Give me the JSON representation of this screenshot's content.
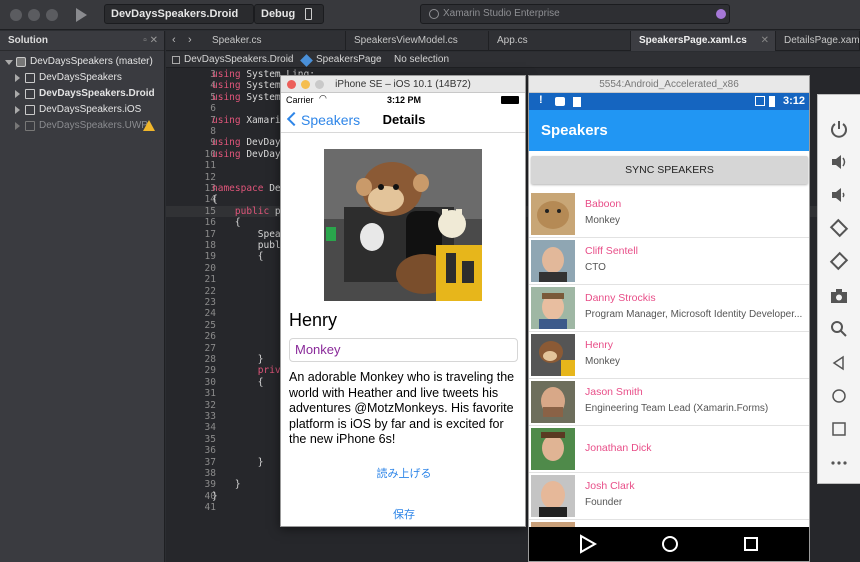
{
  "toolbar": {
    "config_project": "DevDaysSpeakers.Droid",
    "config_mode": "Debug",
    "status": "Xamarin Studio Enterprise"
  },
  "solution": {
    "title": "Solution",
    "root": "DevDaysSpeakers (master)",
    "projects": [
      "DevDaysSpeakers",
      "DevDaysSpeakers.Droid",
      "DevDaysSpeakers.iOS",
      "DevDaysSpeakers.UWP"
    ]
  },
  "tabs": [
    "Speaker.cs",
    "SpeakersViewModel.cs",
    "App.cs",
    "SpeakersPage.xaml.cs",
    "DetailsPage.xaml."
  ],
  "breadcrumbs": {
    "project": "DevDaysSpeakers.Droid",
    "type": "SpeakersPage",
    "member": "No selection"
  },
  "code_lines": [
    {
      "n": "3",
      "a": "using",
      "b": " System.Linq;"
    },
    {
      "n": "4",
      "a": "using",
      "b": " System."
    },
    {
      "n": "5",
      "a": "using",
      "b": " System."
    },
    {
      "n": "6",
      "a": "",
      "b": ""
    },
    {
      "n": "7",
      "a": "using",
      "b": " Xamarin"
    },
    {
      "n": "8",
      "a": "",
      "b": ""
    },
    {
      "n": "9",
      "a": "using",
      "b": " DevDay"
    },
    {
      "n": "10",
      "a": "using",
      "b": " DevDay"
    },
    {
      "n": "11",
      "a": "",
      "b": ""
    },
    {
      "n": "12",
      "a": "",
      "b": ""
    },
    {
      "n": "13",
      "a": "namespace",
      "b": " Dev"
    },
    {
      "n": "14",
      "a": "",
      "b": "{"
    },
    {
      "n": "15",
      "a": "    public",
      "b": " pa"
    },
    {
      "n": "16",
      "a": "",
      "b": "    {"
    },
    {
      "n": "17",
      "a": "",
      "b": "        Spea"
    },
    {
      "n": "18",
      "a": "",
      "b": "        publ"
    },
    {
      "n": "19",
      "a": "",
      "b": "        {"
    },
    {
      "n": "20",
      "a": "",
      "b": "            I"
    },
    {
      "n": "21",
      "a": "",
      "b": ""
    },
    {
      "n": "22",
      "a": "",
      "b": ""
    },
    {
      "n": "23",
      "a": "",
      "b": "            V"
    },
    {
      "n": "24",
      "a": "",
      "b": "            B"
    },
    {
      "n": "25",
      "a": "",
      "b": "            L"
    },
    {
      "n": "26",
      "a": "",
      "b": ""
    },
    {
      "n": "27",
      "a": "",
      "b": ""
    },
    {
      "n": "28",
      "a": "",
      "b": "        }"
    },
    {
      "n": "29",
      "a": "        privat",
      "b": ""
    },
    {
      "n": "30",
      "a": "",
      "b": "        {"
    },
    {
      "n": "31",
      "a": "",
      "b": "            v"
    },
    {
      "n": "32",
      "a": "",
      "b": "            i"
    },
    {
      "n": "33",
      "a": "",
      "b": ""
    },
    {
      "n": "34",
      "a": "",
      "b": "            N"
    },
    {
      "n": "35",
      "a": "",
      "b": ""
    },
    {
      "n": "36",
      "a": "",
      "b": "            L"
    },
    {
      "n": "37",
      "a": "",
      "b": "        }"
    },
    {
      "n": "38",
      "a": "",
      "b": ""
    },
    {
      "n": "39",
      "a": "",
      "b": "    }"
    },
    {
      "n": "40",
      "a": "",
      "b": "}"
    },
    {
      "n": "41",
      "a": "",
      "b": ""
    }
  ],
  "ios": {
    "window_title": "iPhone SE – iOS 10.1 (14B72)",
    "carrier": "Carrier",
    "time": "3:12 PM",
    "back_label": "Speakers",
    "nav_title": "Details",
    "speaker_name": "Henry",
    "speaker_title": "Monkey",
    "description": "An adorable Monkey who is traveling the world with Heather and live tweets his adventures @MotzMonkeys. His favorite platform is iOS by far and is excited for the new iPhone 6s!",
    "speak_button": "読み上げる",
    "save_button": "保存"
  },
  "android": {
    "window_title": "5554:Android_Accelerated_x86",
    "time": "3:12",
    "app_title": "Speakers",
    "sync_button": "SYNC SPEAKERS",
    "speakers": [
      {
        "name": "Baboon",
        "title": "Monkey"
      },
      {
        "name": "Cliff Sentell",
        "title": "CTO"
      },
      {
        "name": "Danny Strockis",
        "title": "Program Manager, Microsoft Identity Developer..."
      },
      {
        "name": "Henry",
        "title": "Monkey"
      },
      {
        "name": "Jason Smith",
        "title": "Engineering Team Lead (Xamarin.Forms)"
      },
      {
        "name": "Jonathan Dick",
        "title": ""
      },
      {
        "name": "Josh Clark",
        "title": "Founder"
      }
    ]
  },
  "colors": {
    "android_primary": "#2196f3",
    "android_status": "#1565c0",
    "android_accent_text": "#e84e88",
    "ios_tint": "#2f86e8"
  }
}
